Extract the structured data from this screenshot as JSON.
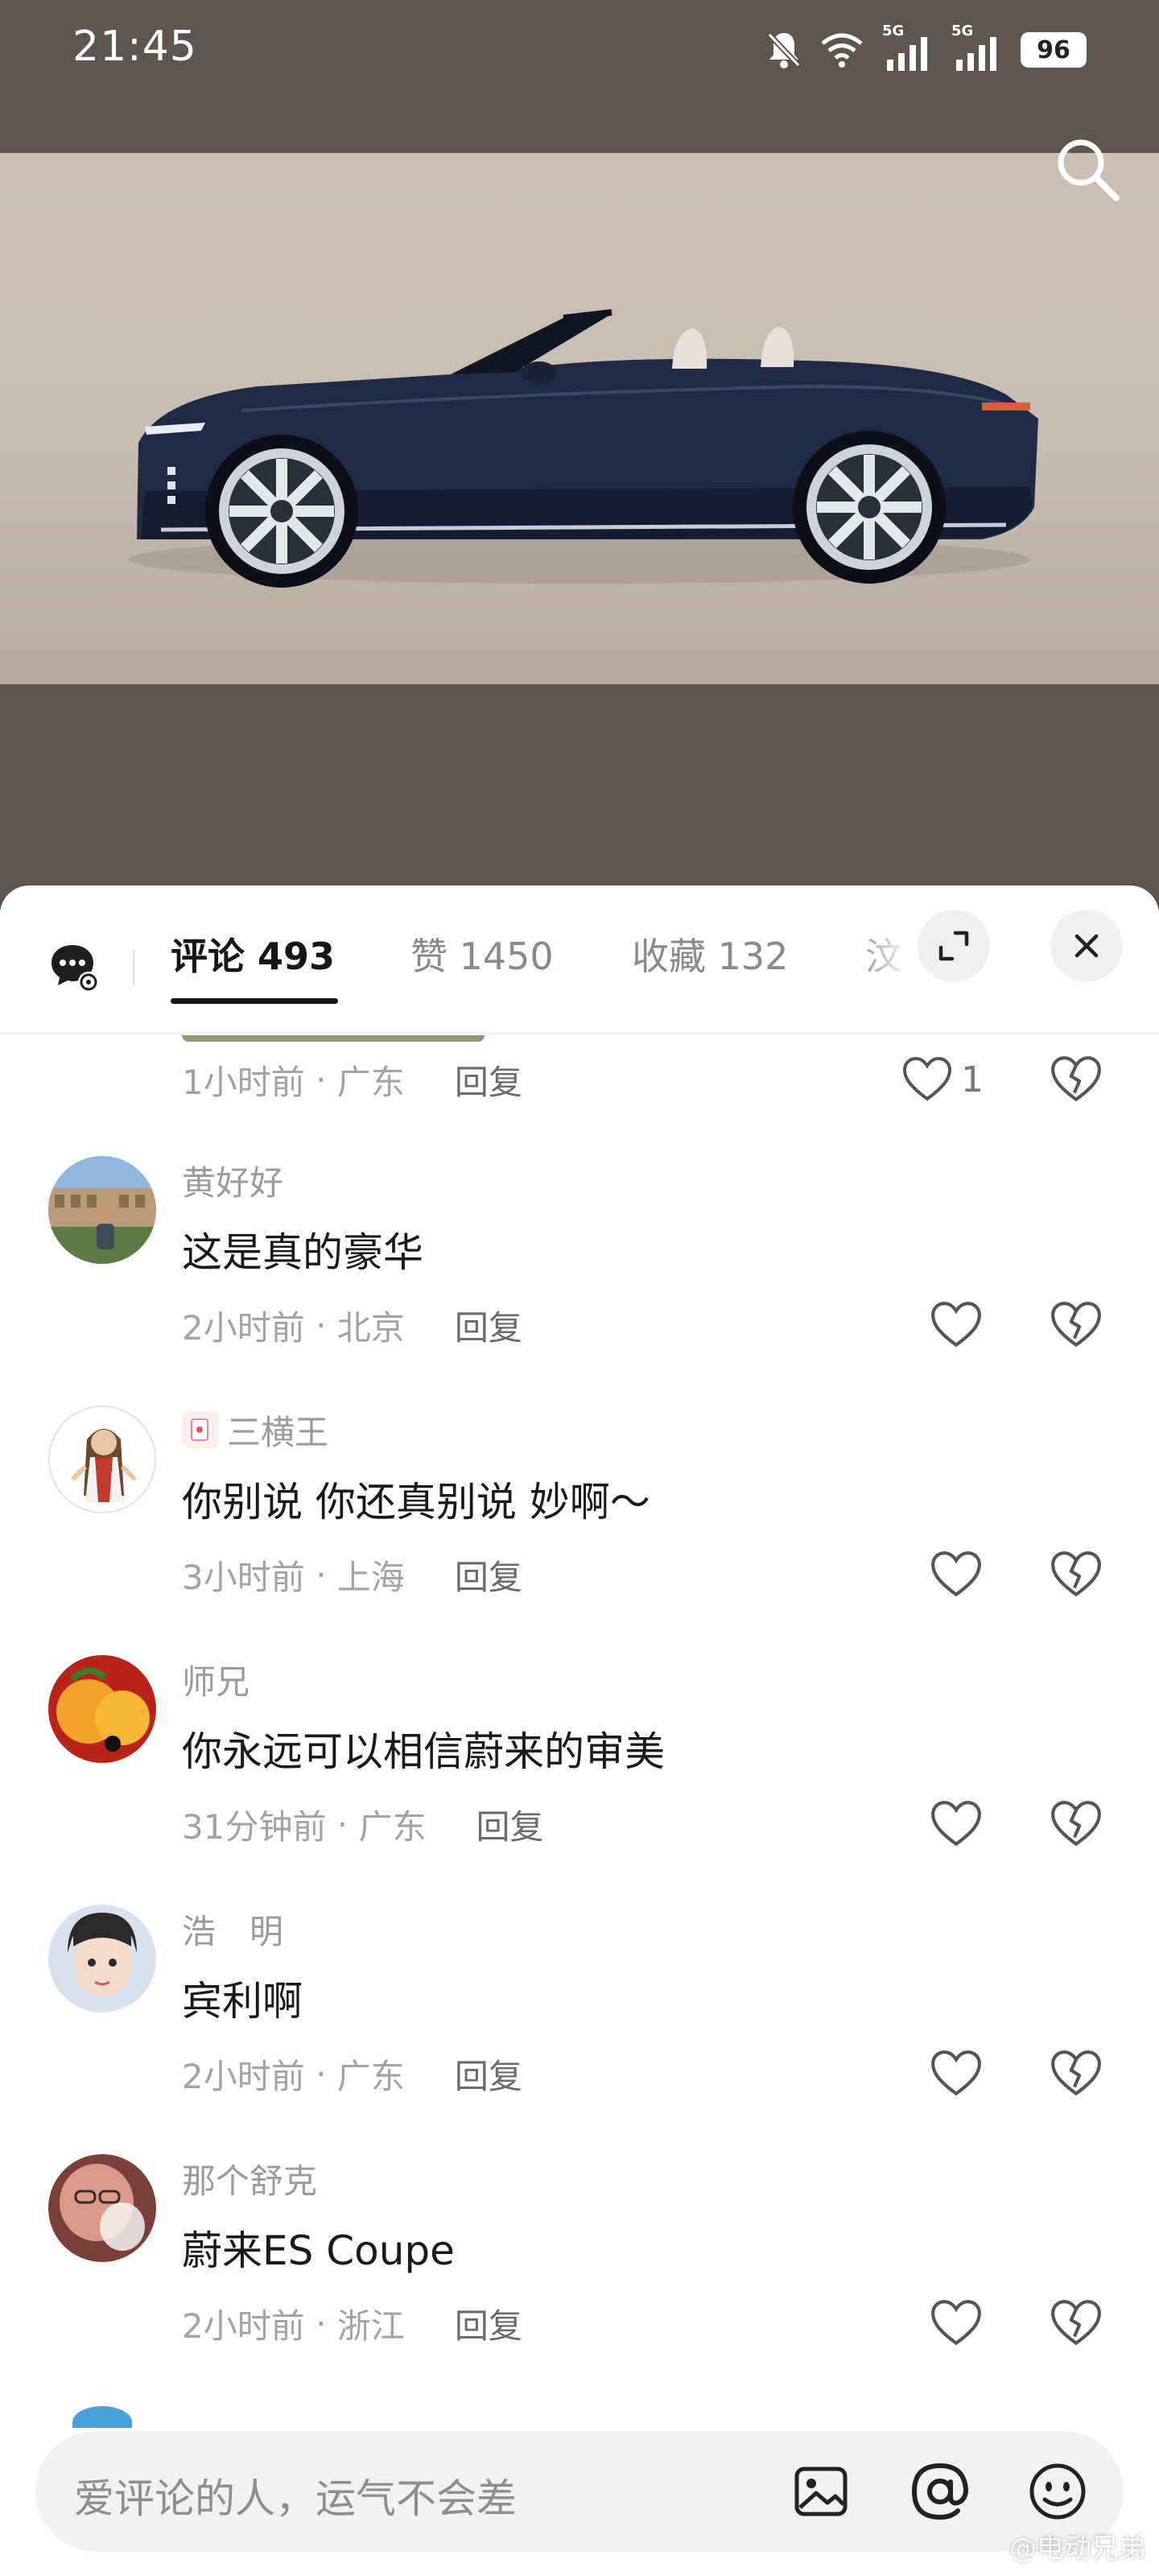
{
  "status_bar": {
    "time": "21:45",
    "network_1": "5G",
    "network_2": "5G",
    "battery": "96"
  },
  "header": {
    "search_icon": "search-icon"
  },
  "tabs": [
    {
      "label": "评论 493",
      "active": true
    },
    {
      "label": "赞 1450",
      "active": false
    },
    {
      "label": "收藏 132",
      "active": false
    },
    {
      "label": "汶",
      "active": false
    }
  ],
  "first_row": {
    "time": "1小时前",
    "location": "广东",
    "reply": "回复",
    "likes": "1"
  },
  "comments": [
    {
      "user": "黄好好",
      "text": "这是真的豪华",
      "time": "2小时前",
      "location": "北京",
      "reply": "回复"
    },
    {
      "user": "三横王",
      "text": "你别说 你还真别说 妙啊～",
      "time": "3小时前",
      "location": "上海",
      "reply": "回复"
    },
    {
      "user": "师兄",
      "text": "你永远可以相信蔚来的审美",
      "time": "31分钟前",
      "location": "广东",
      "reply": "回复"
    },
    {
      "user": "浩　明",
      "text": "宾利啊",
      "time": "2小时前",
      "location": "广东",
      "reply": "回复"
    },
    {
      "user": "那个舒克",
      "text": "蔚来ES Coupe",
      "time": "2小时前",
      "location": "浙江",
      "reply": "回复"
    }
  ],
  "input": {
    "placeholder": "爱评论的人，运气不会差"
  },
  "watermark": "@电动兄弟",
  "colors": {
    "sheet_bg": "#ffffff",
    "top_bg": "#5d5650",
    "meta_gray": "#a3a3a3",
    "text_dark": "#1a1a1a"
  }
}
